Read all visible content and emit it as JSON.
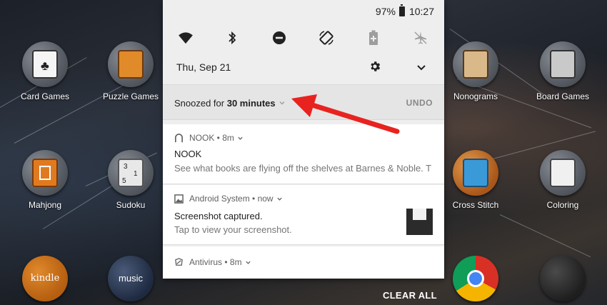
{
  "status_bar": {
    "battery_percent": "97%",
    "time": "10:27"
  },
  "quick_settings": [
    {
      "name": "wifi-icon"
    },
    {
      "name": "bluetooth-icon"
    },
    {
      "name": "do-not-disturb-icon"
    },
    {
      "name": "auto-rotate-icon"
    },
    {
      "name": "battery-saver-icon"
    },
    {
      "name": "airplane-mode-icon"
    }
  ],
  "date": "Thu, Sep 21",
  "snooze": {
    "prefix": "Snoozed for ",
    "duration": "30 minutes",
    "undo_label": "UNDO"
  },
  "notifications": [
    {
      "app": "NOOK",
      "time": "8m",
      "title": "NOOK",
      "body": "See what books are flying off the shelves at Barnes & Noble. T"
    },
    {
      "app": "Android System",
      "time": "now",
      "title": "Screenshot captured.",
      "body": "Tap to view your screenshot."
    },
    {
      "app": "Antivirus",
      "time": "8m"
    }
  ],
  "clear_all_label": "CLEAR ALL",
  "home_apps": {
    "left": [
      {
        "label": "Card Games"
      },
      {
        "label": "Puzzle Games"
      },
      {
        "label": "Mahjong"
      },
      {
        "label": "Sudoku"
      }
    ],
    "right": [
      {
        "label": "Nonograms"
      },
      {
        "label": "Board Games"
      },
      {
        "label": "Cross Stitch"
      },
      {
        "label": "Coloring"
      }
    ],
    "dock": [
      {
        "label": "kindle"
      },
      {
        "label": "music"
      }
    ]
  },
  "colors": {
    "shade_bg": "#eeeeee",
    "arrow": "#e8231f",
    "accent_text": "#212121"
  }
}
